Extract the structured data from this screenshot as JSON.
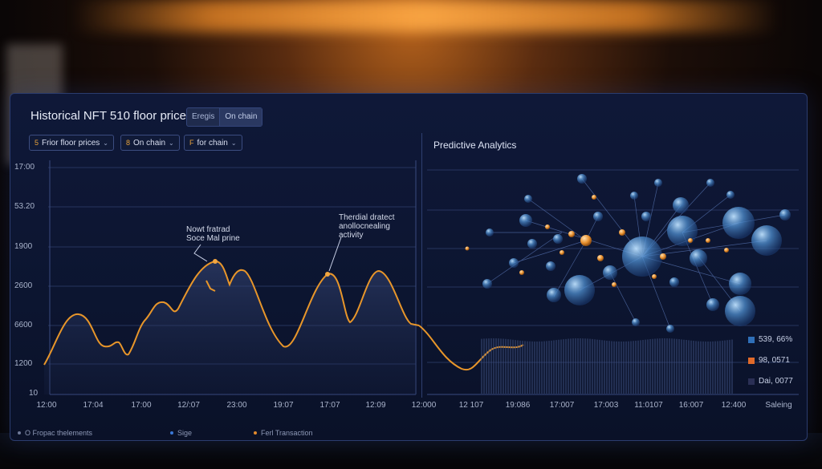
{
  "panel": {
    "title": "Historical NFT 510 floor price",
    "segments": [
      "Eregis",
      "On chain"
    ]
  },
  "filters": [
    {
      "icon": "5",
      "label": "Frior floor prices"
    },
    {
      "icon": "8",
      "label": "On chain"
    },
    {
      "icon": "F",
      "label": "for chain"
    }
  ],
  "predictive": {
    "title": "Predictive Analytics"
  },
  "y_ticks": [
    "17:00",
    "53.20",
    "1900",
    "2600",
    "6600",
    "1200",
    "10"
  ],
  "x_ticks": [
    "12:00",
    "17:04",
    "17:00",
    "12/:07",
    "23:00",
    "19:07",
    "17:07",
    "12:09",
    "12:000",
    "12 107",
    "19:086",
    "17:007",
    "17:003",
    "11:0107",
    "16:007",
    "12:400",
    "Saleing"
  ],
  "annotations": {
    "left": [
      "Nowt fratrad",
      "Soce Mal prine"
    ],
    "right": [
      "Therdial dratect",
      "anollocnealing",
      "activity"
    ]
  },
  "legend": [
    {
      "label": "539, 66%",
      "color": "#2f6fb8"
    },
    {
      "label": "98, 0571",
      "color": "#e06a2a"
    },
    {
      "label": "Dai, 0077",
      "color": "#2a2f55"
    }
  ],
  "footer": [
    {
      "label": "O Fropac thelements",
      "color": "#6f7a98"
    },
    {
      "label": "Sige",
      "color": "#3a78d6"
    },
    {
      "label": "Ferl Transaction",
      "color": "#e38a2c"
    }
  ],
  "colors": {
    "line": "#e8962a",
    "accent_orange": "#f2a640",
    "bubble": "#5a9ee0"
  }
}
